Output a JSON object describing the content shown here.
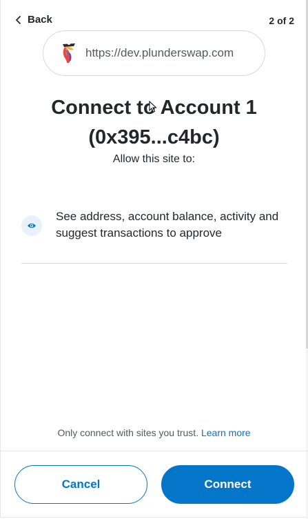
{
  "header": {
    "back_label": "Back",
    "step_indicator": "2 of 2"
  },
  "site": {
    "url": "https://dev.plunderswap.com",
    "logo_icon": "pirate-parrot-logo"
  },
  "title": {
    "line1": "Connect to Account 1",
    "line2": "(0x395...c4bc)"
  },
  "subtitle": "Allow this site to:",
  "permissions": [
    {
      "icon": "eye-icon",
      "text": "See address, account balance, activity and suggest transactions to approve"
    }
  ],
  "footer": {
    "trust_note": "Only connect with sites you trust.",
    "learn_more": "Learn more"
  },
  "actions": {
    "cancel_label": "Cancel",
    "connect_label": "Connect"
  },
  "colors": {
    "accent": "#0376c9",
    "text_primary": "#24272a",
    "text_secondary": "#535a61",
    "border": "#d6d9dc"
  }
}
